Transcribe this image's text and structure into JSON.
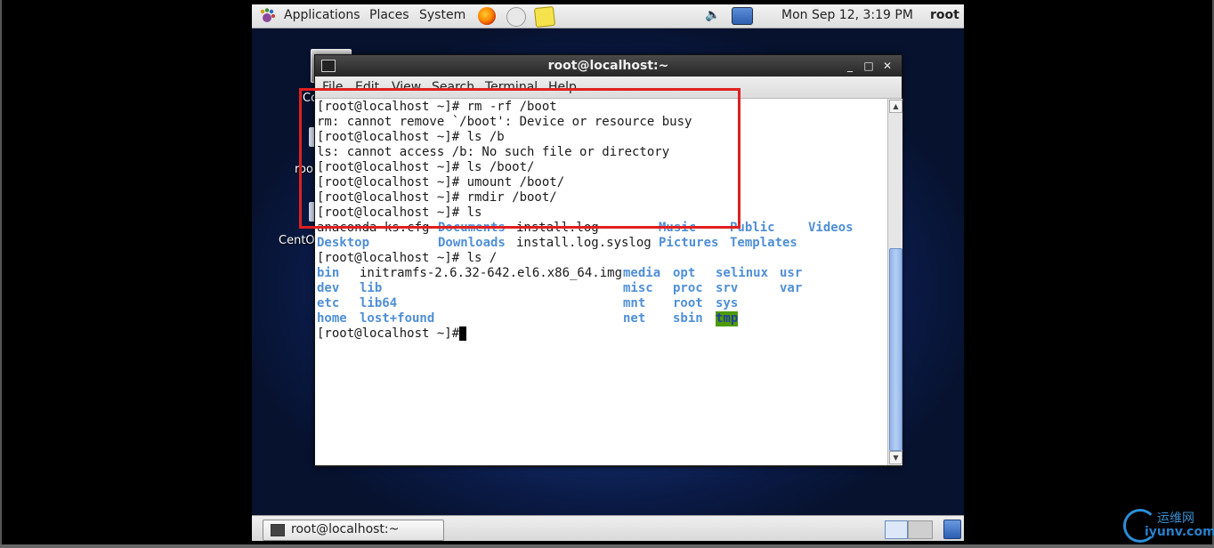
{
  "top_panel": {
    "menus": [
      "Applications",
      "Places",
      "System"
    ],
    "clock": "Mon Sep 12,  3:19 PM",
    "user": "root"
  },
  "desktop": {
    "icon_labels": [
      "Co",
      "roo",
      "CentO"
    ]
  },
  "terminal": {
    "title": "root@localhost:~",
    "window_buttons": [
      "_",
      "□",
      "✕"
    ],
    "menu": [
      "File",
      "Edit",
      "View",
      "Search",
      "Terminal",
      "Help"
    ],
    "lines": [
      "[root@localhost ~]# rm -rf /boot",
      "rm: cannot remove `/boot': Device or resource busy",
      "[root@localhost ~]# ls /b",
      "ls: cannot access /b: No such file or directory",
      "[root@localhost ~]# ls /boot/",
      "[root@localhost ~]# umount /boot/",
      "[root@localhost ~]# rmdir /boot/",
      "[root@localhost ~]# ls"
    ],
    "home_listing": {
      "row1": {
        "c1": "anaconda-ks.cfg",
        "c2": "Documents",
        "c3": "install.log",
        "c4": "Music",
        "c5": "Public",
        "c6": "Videos"
      },
      "row2": {
        "c1": "Desktop",
        "c2": "Downloads",
        "c3": "install.log.syslog",
        "c4": "Pictures",
        "c5": "Templates"
      }
    },
    "ls_root_cmd": "[root@localhost ~]# ls /",
    "root_listing": {
      "col1": [
        "bin",
        "dev",
        "etc",
        "home"
      ],
      "col2": [
        "initramfs-2.6.32-642.el6.x86_64.img",
        "lib",
        "lib64",
        "lost+found"
      ],
      "col3": [
        "media",
        "misc",
        "mnt",
        "net"
      ],
      "col4": [
        "opt",
        "proc",
        "root",
        "sbin"
      ],
      "col5": [
        "selinux",
        "srv",
        "sys",
        "tmp"
      ],
      "col6": [
        "usr",
        "var"
      ]
    },
    "prompt": "[root@localhost ~]#"
  },
  "taskbar": {
    "task_label": "root@localhost:~"
  },
  "watermark": {
    "cn": "运维网",
    "en": "iyunv.com"
  },
  "colors": {
    "directory": "#4f8fd6",
    "highlight_bg": "#4e9a06",
    "annotation": "#e02020"
  }
}
